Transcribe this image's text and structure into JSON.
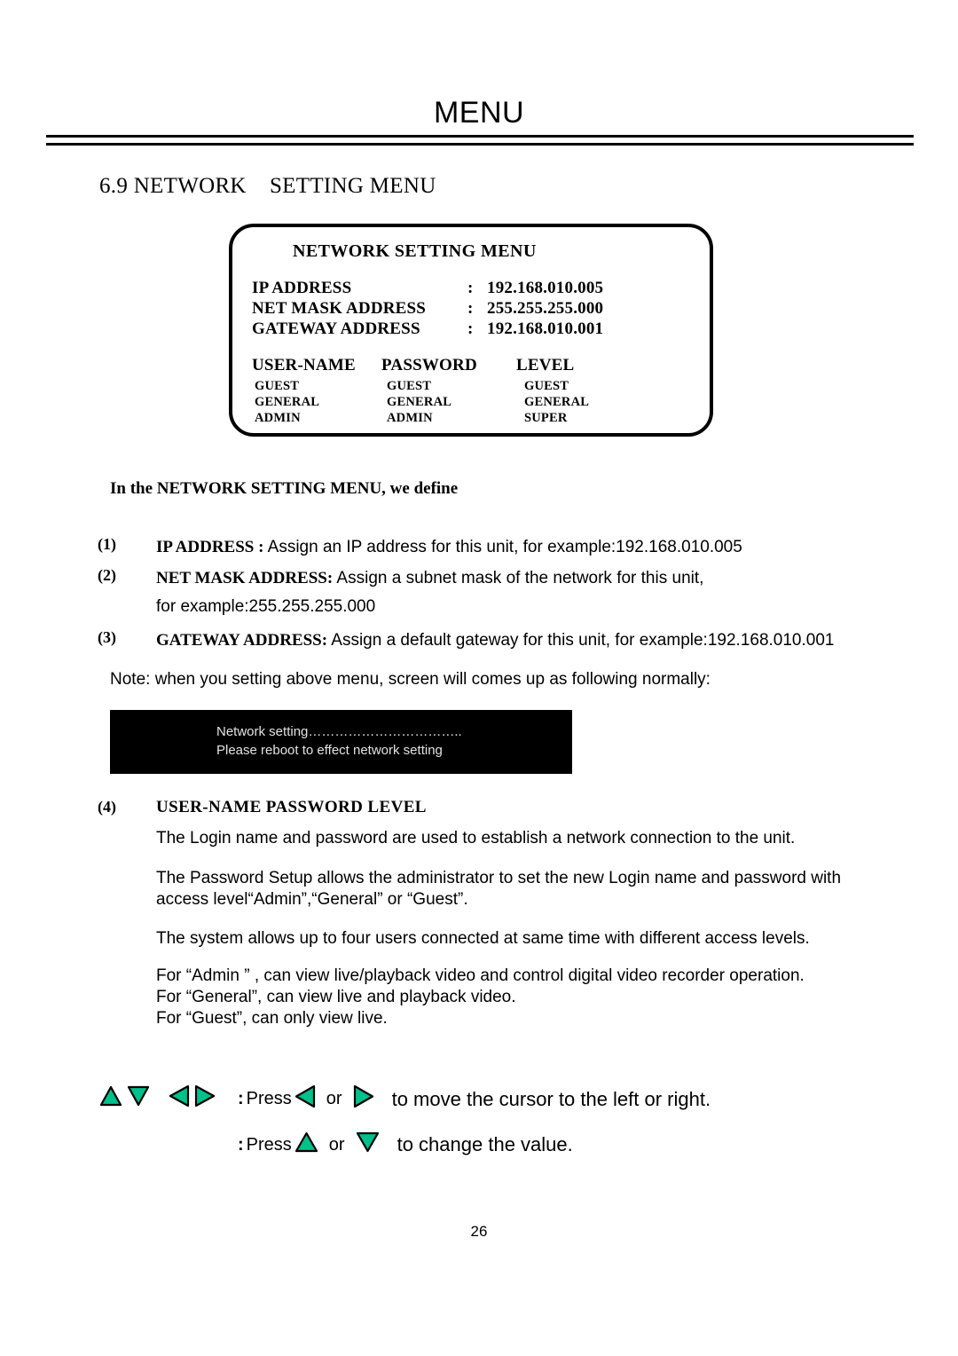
{
  "header": {
    "title": "MENU",
    "section_heading": "6.9 NETWORK    SETTING MENU"
  },
  "osd_menu": {
    "title": "NETWORK SETTING MENU",
    "colon": ":",
    "fields": [
      {
        "label": "IP ADDRESS",
        "value": "192.168.010.005"
      },
      {
        "label": "NET MASK ADDRESS",
        "value": "255.255.255.000"
      },
      {
        "label": "GATEWAY ADDRESS",
        "value": "192.168.010.001"
      }
    ],
    "user_table": {
      "headers": [
        "USER-NAME",
        "PASSWORD",
        "LEVEL"
      ],
      "rows": [
        [
          "GUEST",
          "GUEST",
          "GUEST"
        ],
        [
          "GENERAL",
          "GENERAL",
          "GENERAL"
        ],
        [
          "ADMIN",
          "ADMIN",
          "SUPER"
        ]
      ]
    }
  },
  "body": {
    "define_line": "In the NETWORK SETTING MENU, we define",
    "items": [
      {
        "num": "(1)",
        "bold": "IP ADDRESS :",
        "text": " Assign an IP address for this unit, for example:192.168.010.005"
      },
      {
        "num": "(2)",
        "bold": "NET MASK ADDRESS:",
        "text": " Assign a subnet mask of the network for this unit,",
        "continuation": "for example:255.255.255.000"
      },
      {
        "num": "(3)",
        "bold": "GATEWAY ADDRESS:",
        "text": " Assign a default gateway for this unit, for example:192.168.010.001"
      }
    ],
    "note": "Note: when you setting above menu, screen will comes up as following normally:",
    "osd_message": {
      "line1": "Network setting……………………………..",
      "line2": "Please reboot to effect network setting",
      "background": "#000000",
      "text_color": "#e2e2e2"
    },
    "section4": {
      "num": "(4)",
      "title": "USER-NAME  PASSWORD  LEVEL",
      "paragraphs": [
        "The Login name and password are used to establish a network connection to the unit.",
        "The Password Setup allows the administrator to set the new Login name and password with",
        "access level“Admin”,“General” or “Guest”.",
        "The system allows up to four users connected at same time with different access levels.",
        "For “Admin ” , can view live/playback video and control digital video recorder operation.",
        "For “General”, can view live and playback video.",
        "For “Guest”, can only view live."
      ]
    }
  },
  "legend": {
    "arrow_color": "#00c08c",
    "arrow_outline": "#000000",
    "cluster_icons": [
      "triangle-up",
      "triangle-down",
      "triangle-left",
      "triangle-right"
    ],
    "lines": [
      {
        "colon": ":",
        "press": "Press",
        "icon_a": "triangle-left",
        "or": "or",
        "icon_b": "triangle-right",
        "tail": "to move the cursor to the left or right."
      },
      {
        "colon": ":",
        "press": "Press",
        "icon_a": "triangle-up",
        "or": "or",
        "icon_b": "triangle-down",
        "tail": "to change the value."
      }
    ]
  },
  "footer": {
    "page_number": "26"
  }
}
